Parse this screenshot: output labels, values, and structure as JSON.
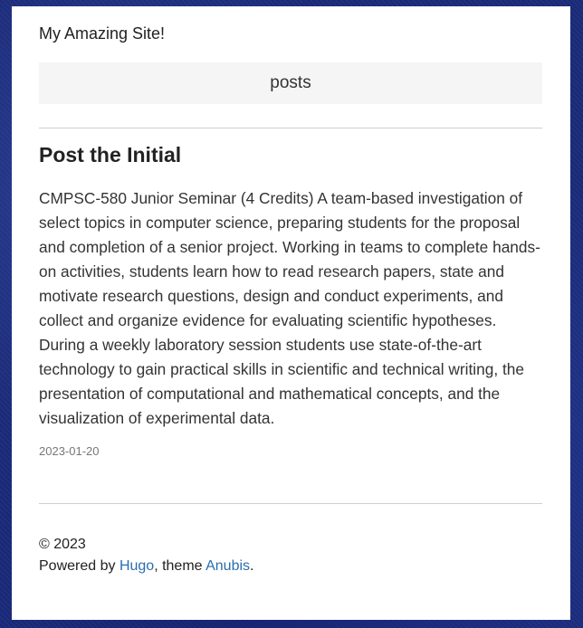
{
  "site": {
    "title": "My Amazing Site!"
  },
  "nav": {
    "items": [
      {
        "label": "posts"
      }
    ]
  },
  "post": {
    "title": "Post the Initial",
    "body": "CMPSC-580 Junior Seminar (4 Credits) A team-based investigation of select topics in computer science, preparing students for the proposal and completion of a senior project. Working in teams to complete hands-on activities, students learn how to read research papers, state and motivate research questions, design and conduct experiments, and collect and organize evidence for evaluating scientific hypotheses. During a weekly laboratory session students use state-of-the-art technology to gain practical skills in scientific and technical writing, the presentation of computational and mathematical concepts, and the visualization of experimental data.",
    "date": "2023-01-20"
  },
  "footer": {
    "copyright": "© 2023",
    "powered_prefix": "Powered by ",
    "hugo_link": "Hugo",
    "theme_text": ", theme ",
    "theme_link": "Anubis",
    "period": "."
  },
  "colors": {
    "link": "#2a6db0",
    "page_background": "#1a2a7a",
    "nav_background": "#f5f5f5"
  }
}
